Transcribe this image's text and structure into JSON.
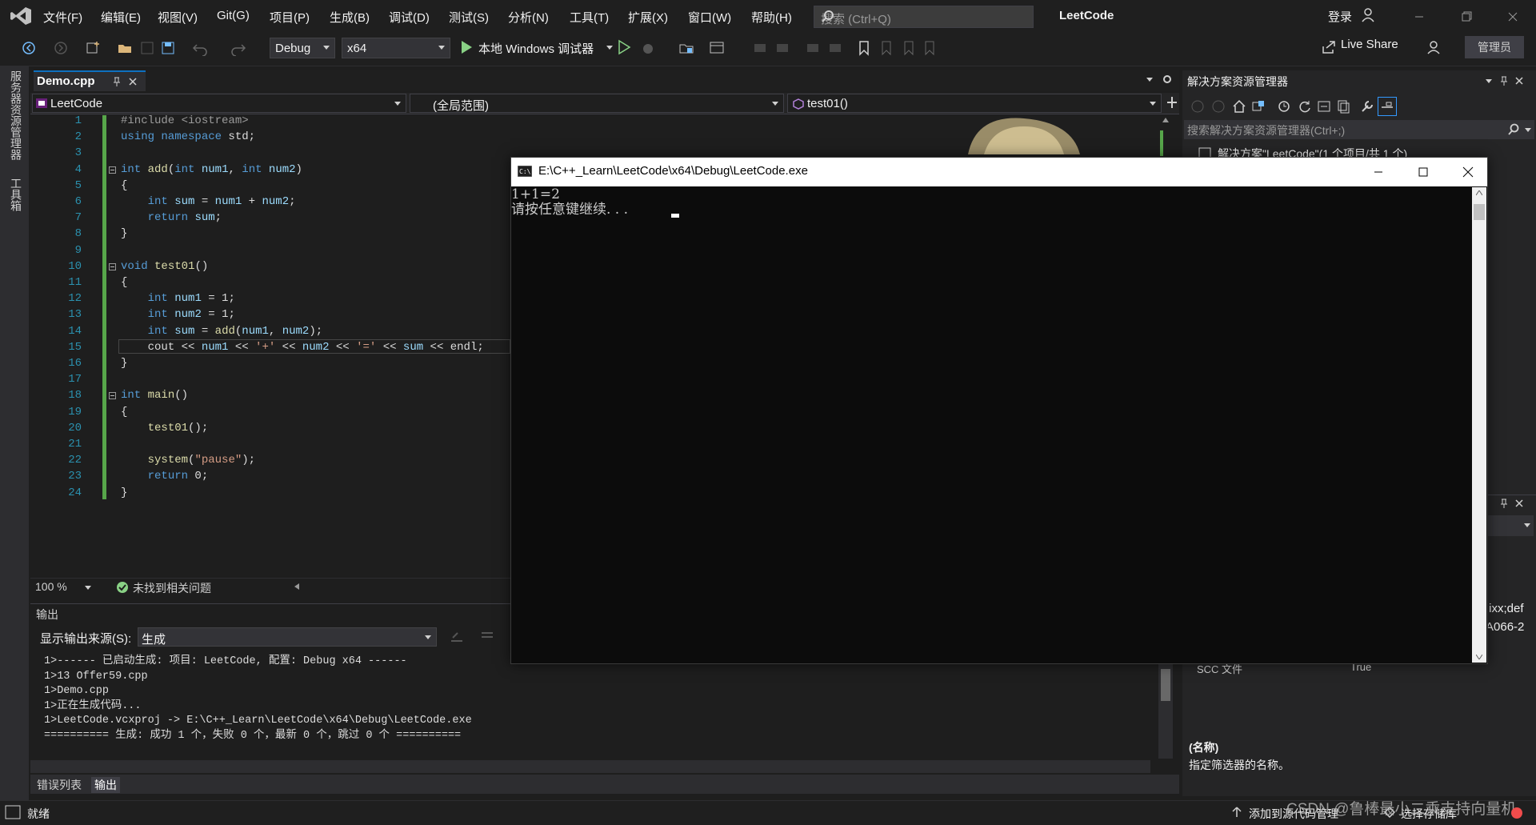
{
  "menubar": {
    "items": [
      "文件(F)",
      "编辑(E)",
      "视图(V)",
      "Git(G)",
      "项目(P)",
      "生成(B)",
      "调试(D)",
      "测试(S)",
      "分析(N)",
      "工具(T)",
      "扩展(X)",
      "窗口(W)",
      "帮助(H)"
    ],
    "search_placeholder": "搜索 (Ctrl+Q)",
    "app_title": "LeetCode",
    "login": "登录"
  },
  "toolbar": {
    "config": "Debug",
    "platform": "x64",
    "debugger": "本地 Windows 调试器",
    "live_share": "Live Share",
    "admin": "管理员"
  },
  "left_strip": {
    "tab1": "服务器资源管理器",
    "tab2": "工具箱"
  },
  "editor": {
    "tab_name": "Demo.cpp",
    "nav_project": "LeetCode",
    "nav_scope": "(全局范围)",
    "nav_member": "test01()",
    "zoom": "100 %",
    "issues": "未找到相关问题",
    "lines": [
      {
        "n": "1",
        "html": "<span class=\"pp\">#include &lt;iostream&gt;</span>"
      },
      {
        "n": "2",
        "html": "<span class=\"kw\">using namespace</span> std;"
      },
      {
        "n": "3",
        "html": ""
      },
      {
        "n": "4",
        "html": "<span class=\"kw\">int</span> <span class=\"fn\">add</span>(<span class=\"kw\">int</span> <span class=\"var\">num1</span>, <span class=\"kw\">int</span> <span class=\"var\">num2</span>)"
      },
      {
        "n": "5",
        "html": "{"
      },
      {
        "n": "6",
        "html": "    <span class=\"kw\">int</span> <span class=\"var\">sum</span> = <span class=\"var\">num1</span> + <span class=\"var\">num2</span>;"
      },
      {
        "n": "7",
        "html": "    <span class=\"kw\">return</span> <span class=\"var\">sum</span>;"
      },
      {
        "n": "8",
        "html": "}"
      },
      {
        "n": "9",
        "html": ""
      },
      {
        "n": "10",
        "html": "<span class=\"kw\">void</span> <span class=\"fn\">test01</span>()"
      },
      {
        "n": "11",
        "html": "{"
      },
      {
        "n": "12",
        "html": "    <span class=\"kw\">int</span> <span class=\"var\">num1</span> = 1;"
      },
      {
        "n": "13",
        "html": "    <span class=\"kw\">int</span> <span class=\"var\">num2</span> = 1;"
      },
      {
        "n": "14",
        "html": "    <span class=\"kw\">int</span> <span class=\"var\">sum</span> = <span class=\"fn\">add</span>(<span class=\"var\">num1</span>, <span class=\"var\">num2</span>);"
      },
      {
        "n": "15",
        "html": "    cout &lt;&lt; <span class=\"var\">num1</span> &lt;&lt; <span class=\"str\">'+'</span> &lt;&lt; <span class=\"var\">num2</span> &lt;&lt; <span class=\"str\">'='</span> &lt;&lt; <span class=\"var\">sum</span> &lt;&lt; endl;"
      },
      {
        "n": "16",
        "html": "}"
      },
      {
        "n": "17",
        "html": ""
      },
      {
        "n": "18",
        "html": "<span class=\"kw\">int</span> <span class=\"fn\">main</span>()"
      },
      {
        "n": "19",
        "html": "{"
      },
      {
        "n": "20",
        "html": "    <span class=\"fn\">test01</span>();"
      },
      {
        "n": "21",
        "html": ""
      },
      {
        "n": "22",
        "html": "    <span class=\"fn\">system</span>(<span class=\"str\">\"pause\"</span>);"
      },
      {
        "n": "23",
        "html": "    <span class=\"kw\">return</span> 0;"
      },
      {
        "n": "24",
        "html": "}"
      }
    ]
  },
  "output": {
    "title": "输出",
    "source_label": "显示输出来源(S):",
    "source_value": "生成",
    "text": "1>------ 已启动生成: 项目: LeetCode, 配置: Debug x64 ------\n1>13 Offer59.cpp\n1>Demo.cpp\n1>正在生成代码...\n1>LeetCode.vcxproj -> E:\\C++_Learn\\LeetCode\\x64\\Debug\\LeetCode.exe\n========== 生成: 成功 1 个，失败 0 个，最新 0 个，跳过 0 个 ==========",
    "tab_errors": "错误列表",
    "tab_output": "输出"
  },
  "solution_explorer": {
    "title": "解决方案资源管理器",
    "search_placeholder": "搜索解决方案资源管理器(Ctrl+;)",
    "tree_item": "解决方案\"LeetCode\"(1 个项目/共 1 个)",
    "props_text1": ";ixx;def",
    "props_text2": "A066-2",
    "props_row_name": "SCC 文件",
    "props_row_value": "True",
    "desc_title": "(名称)",
    "desc_text": "指定筛选器的名称。"
  },
  "console": {
    "title": "E:\\C++_Learn\\LeetCode\\x64\\Debug\\LeetCode.exe",
    "text": "1+1=2\n请按任意键继续. . ."
  },
  "statusbar": {
    "ready": "就绪",
    "add_source": "添加到源代码管理",
    "select_repo": "选择存储库",
    "watermark": "CSDN @鲁棒最小二乘支持向量机"
  }
}
